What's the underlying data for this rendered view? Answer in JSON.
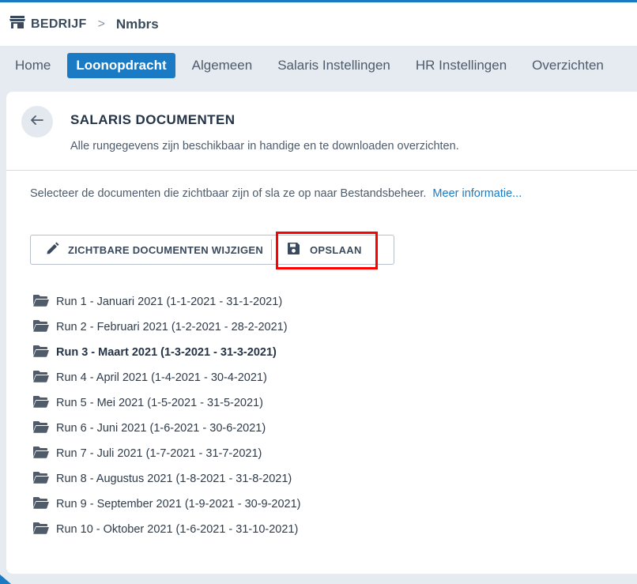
{
  "breadcrumb": {
    "company_label": "BEDRIJF",
    "separator": ">",
    "current": "Nmbrs"
  },
  "nav": {
    "tabs": [
      {
        "label": "Home",
        "active": false
      },
      {
        "label": "Loonopdracht",
        "active": true
      },
      {
        "label": "Algemeen",
        "active": false
      },
      {
        "label": "Salaris Instellingen",
        "active": false
      },
      {
        "label": "HR Instellingen",
        "active": false
      },
      {
        "label": "Overzichten",
        "active": false
      }
    ]
  },
  "header": {
    "title": "SALARIS DOCUMENTEN",
    "subtitle": "Alle rungegevens zijn beschikbaar in handige en te downloaden overzichten."
  },
  "info": {
    "text": "Selecteer de documenten die zichtbaar zijn of sla ze op naar Bestandsbeheer.",
    "link": "Meer informatie..."
  },
  "actions": {
    "edit_label": "ZICHTBARE DOCUMENTEN WIJZIGEN",
    "save_label": "OPSLAAN"
  },
  "runs": [
    {
      "label": "Run 1 - Januari 2021 (1-1-2021 - 31-1-2021)",
      "bold": false
    },
    {
      "label": "Run 2 - Februari 2021 (1-2-2021 - 28-2-2021)",
      "bold": false
    },
    {
      "label": "Run 3 - Maart 2021 (1-3-2021 - 31-3-2021)",
      "bold": true
    },
    {
      "label": "Run 4 - April 2021 (1-4-2021 - 30-4-2021)",
      "bold": false
    },
    {
      "label": "Run 5 - Mei 2021 (1-5-2021 - 31-5-2021)",
      "bold": false
    },
    {
      "label": "Run 6 - Juni 2021 (1-6-2021 - 30-6-2021)",
      "bold": false
    },
    {
      "label": "Run 7 - Juli 2021 (1-7-2021 - 31-7-2021)",
      "bold": false
    },
    {
      "label": "Run 8 - Augustus 2021 (1-8-2021 - 31-8-2021)",
      "bold": false
    },
    {
      "label": "Run 9 - September 2021 (1-9-2021 - 30-9-2021)",
      "bold": false
    },
    {
      "label": "Run 10 - Oktober 2021 (1-6-2021 - 31-10-2021)",
      "bold": false
    }
  ],
  "colors": {
    "accent": "#1a7bc4",
    "highlight": "#ff0000",
    "background": "#e6ebf1"
  },
  "icons": {
    "company": "store-icon",
    "back": "arrow-left-icon",
    "edit": "pencil-icon",
    "save": "floppy-disk-icon",
    "run": "folder-open-icon"
  }
}
